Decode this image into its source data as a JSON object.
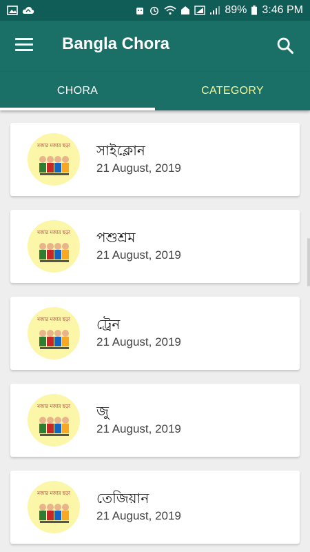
{
  "status_bar": {
    "battery": "89%",
    "time": "3:46 PM"
  },
  "app_bar": {
    "title": "Bangla Chora",
    "menu_icon": "menu-icon",
    "search_icon": "search-icon"
  },
  "tabs": [
    {
      "label": "CHORA",
      "active": true
    },
    {
      "label": "CATEGORY",
      "active": false
    }
  ],
  "colors": {
    "primary": "#1a7067",
    "primary_dark": "#0f5d56",
    "tab_inactive": "#f2f59a",
    "thumb_bg": "#fbf6a8"
  },
  "items": [
    {
      "title": "সাইক্লোন",
      "date": "21 August, 2019",
      "thumb_text": "মজার মজার ছড়া"
    },
    {
      "title": "পশুশ্রম",
      "date": "21 August, 2019",
      "thumb_text": "মজার মজার ছড়া"
    },
    {
      "title": "ট্রেন",
      "date": "21 August, 2019",
      "thumb_text": "মজার মজার ছড়া"
    },
    {
      "title": "জু",
      "date": "21 August, 2019",
      "thumb_text": "মজার মজার ছড়া"
    },
    {
      "title": "তেজিয়ান",
      "date": "21 August, 2019",
      "thumb_text": "মজার মজার ছড়া"
    }
  ]
}
